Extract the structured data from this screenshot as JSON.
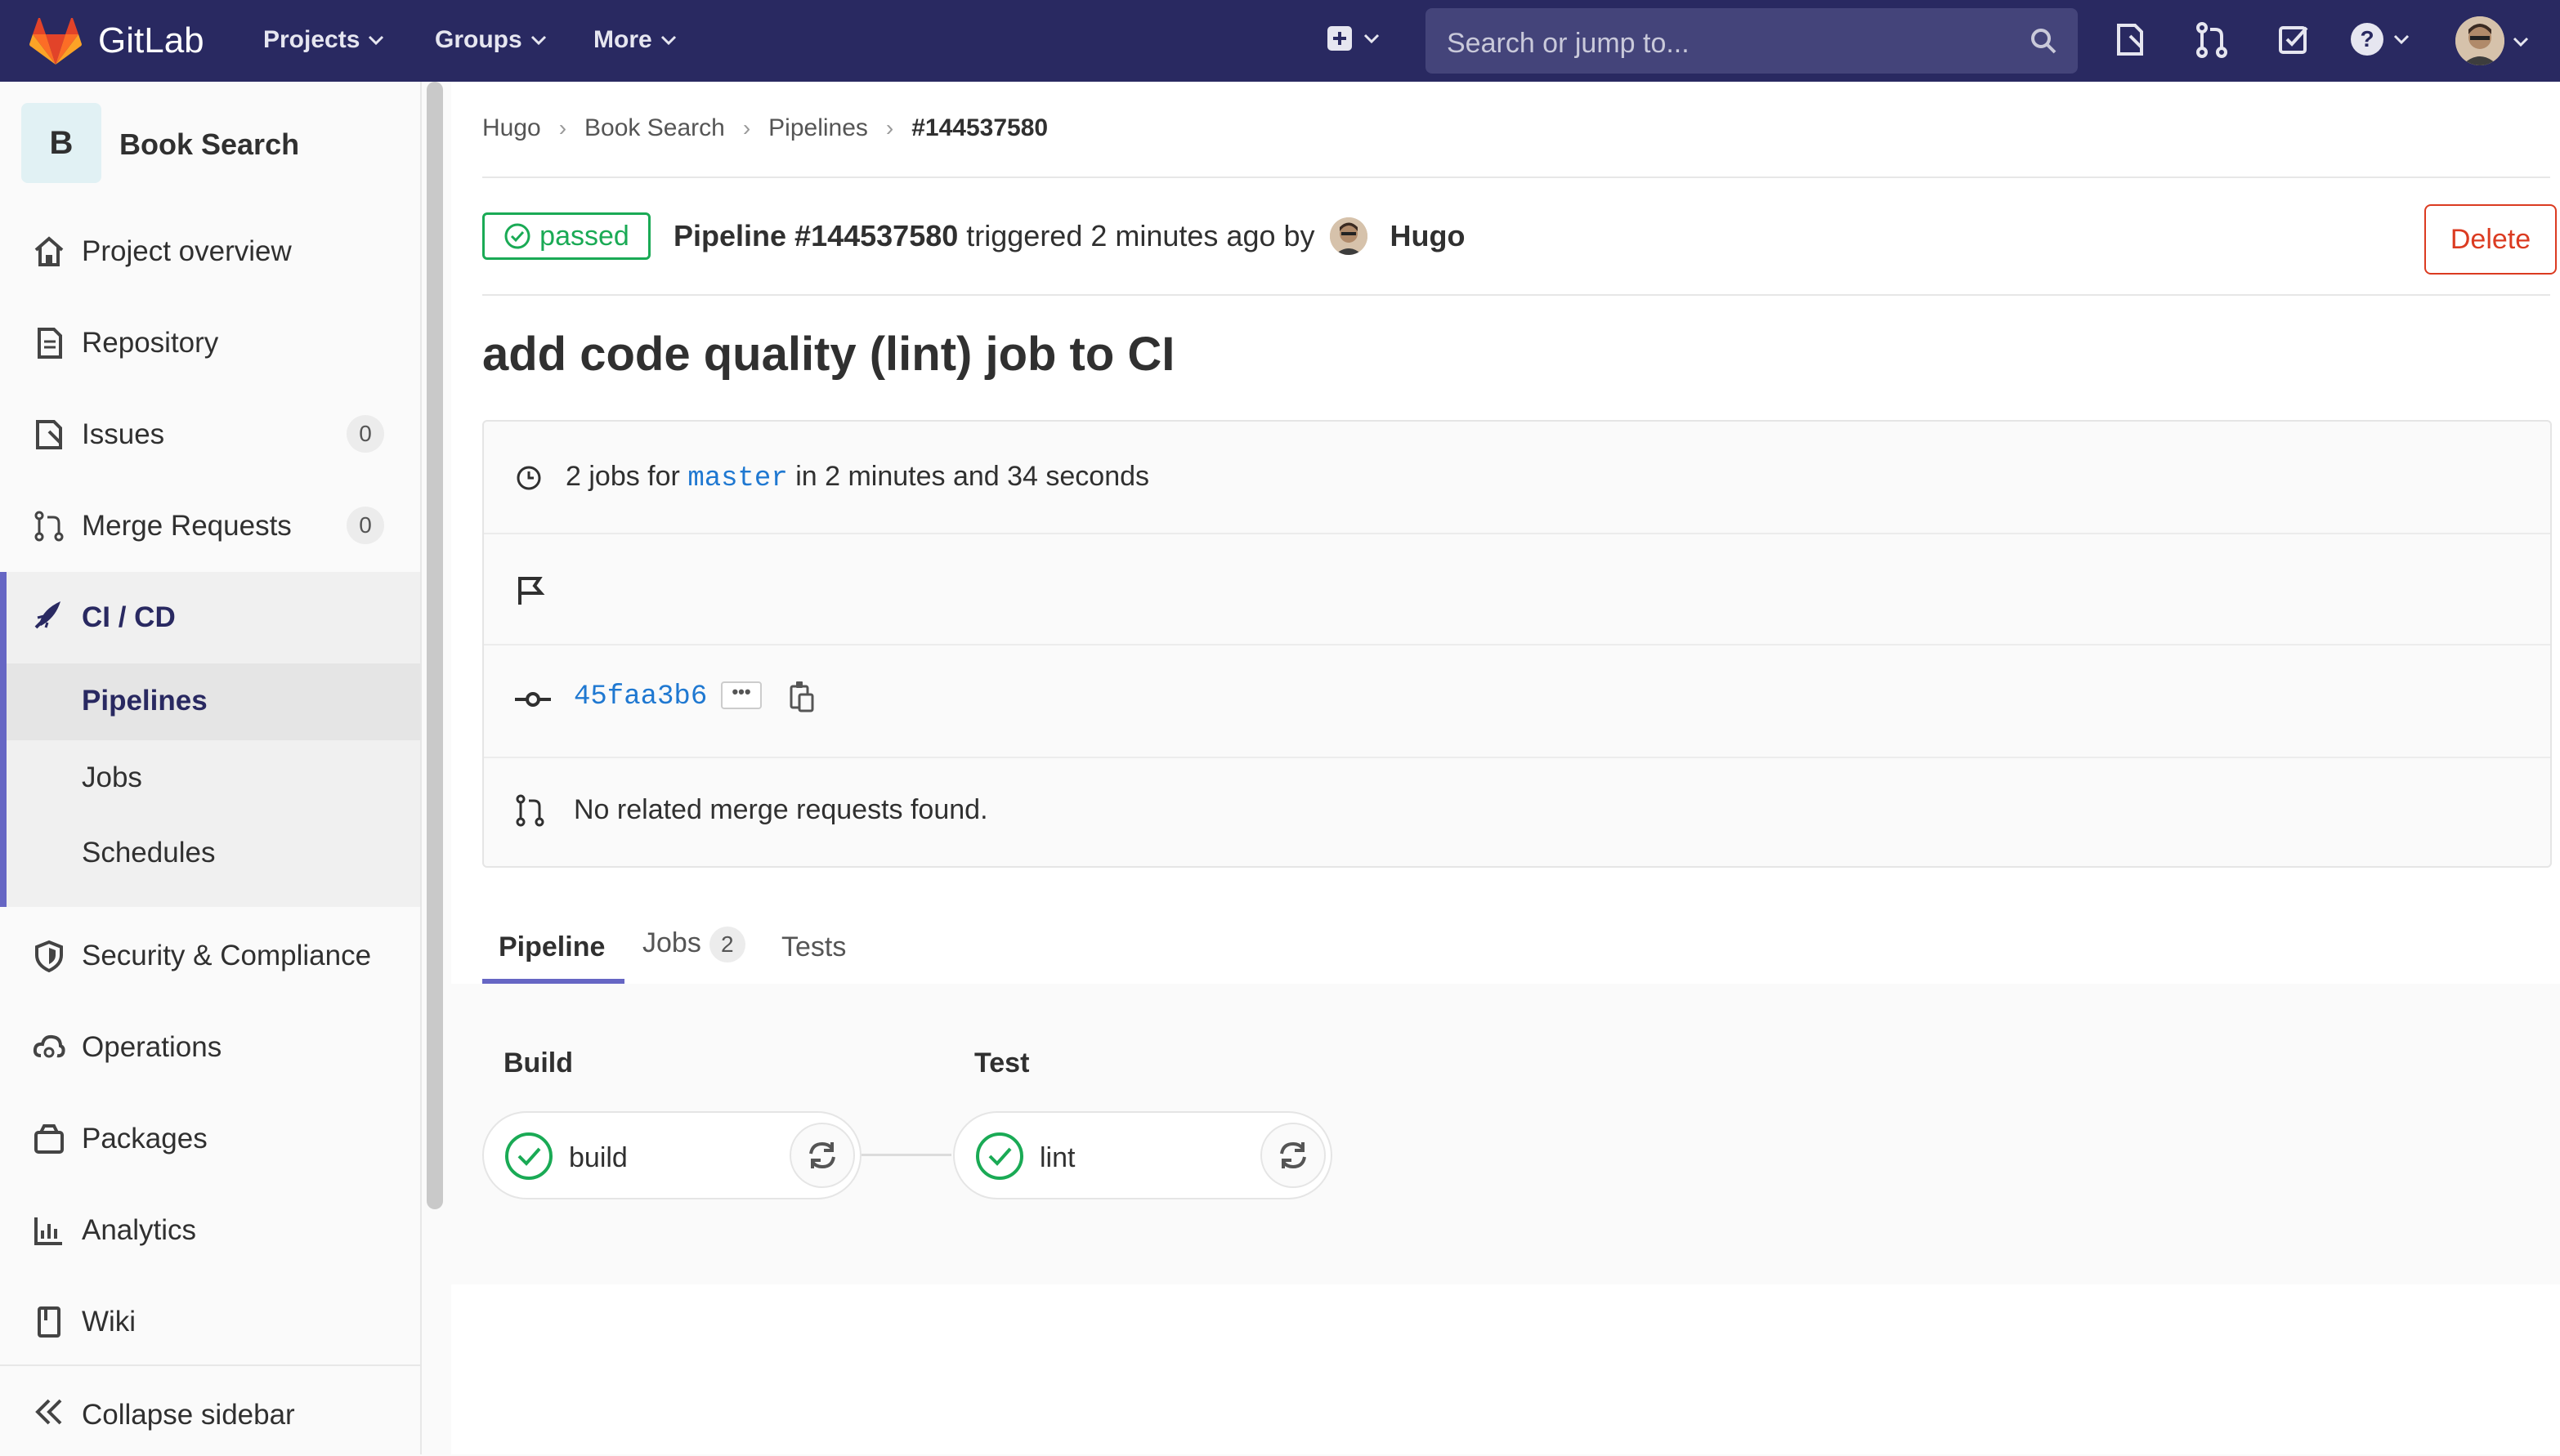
{
  "navbar": {
    "brand": "GitLab",
    "menus": [
      "Projects",
      "Groups",
      "More"
    ],
    "search_placeholder": "Search or jump to..."
  },
  "sidebar": {
    "project_initial": "B",
    "project_name": "Book Search",
    "items": [
      {
        "label": "Project overview"
      },
      {
        "label": "Repository"
      },
      {
        "label": "Issues",
        "count": "0"
      },
      {
        "label": "Merge Requests",
        "count": "0"
      },
      {
        "label": "CI / CD"
      },
      {
        "label": "Security & Compliance"
      },
      {
        "label": "Operations"
      },
      {
        "label": "Packages"
      },
      {
        "label": "Analytics"
      },
      {
        "label": "Wiki"
      }
    ],
    "cicd_sub": [
      "Pipelines",
      "Jobs",
      "Schedules"
    ],
    "collapse_label": "Collapse sidebar"
  },
  "breadcrumb": [
    "Hugo",
    "Book Search",
    "Pipelines",
    "#144537580"
  ],
  "pipeline": {
    "status": "passed",
    "title_strong": "Pipeline #144537580",
    "title_rest": "triggered 2 minutes ago by",
    "author": "Hugo",
    "delete_label": "Delete",
    "commit_title": "add code quality (lint) job to CI",
    "jobs_prefix": "2 jobs for",
    "branch": "master",
    "duration": "in 2 minutes and 34 seconds",
    "commit_sha": "45faa3b6",
    "ellipsis": "•••",
    "merge_requests_text": "No related merge requests found."
  },
  "tabs": [
    {
      "label": "Pipeline"
    },
    {
      "label": "Jobs",
      "count": "2"
    },
    {
      "label": "Tests"
    }
  ],
  "stages": [
    {
      "name": "Build",
      "job": "build"
    },
    {
      "name": "Test",
      "job": "lint"
    }
  ],
  "colors": {
    "navbar": "#292961",
    "success": "#1aaa55",
    "danger": "#db3b21",
    "link": "#1f78d1",
    "accent": "#6666c4"
  }
}
